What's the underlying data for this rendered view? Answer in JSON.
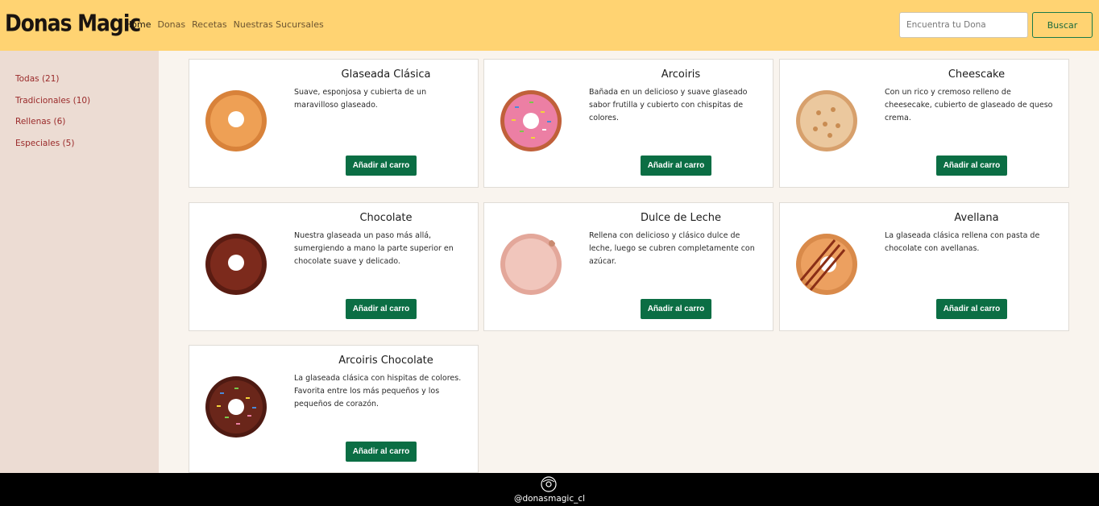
{
  "brand": "Donas Magic",
  "nav": {
    "home": "Home",
    "donas": "Donas",
    "recetas": "Recetas",
    "sucursales": "Nuestras Sucursales"
  },
  "search": {
    "placeholder": "Encuentra tu Dona",
    "button": "Buscar"
  },
  "sidebar": {
    "items": [
      {
        "label": "Todas (21)"
      },
      {
        "label": "Tradicionales (10)"
      },
      {
        "label": "Rellenas (6)"
      },
      {
        "label": "Especiales (5)"
      }
    ]
  },
  "products": [
    {
      "title": "Glaseada Clásica",
      "desc": "Suave, esponjosa y cubierta de un maravilloso glaseado.",
      "button": "Añadir al carro",
      "color": "#d8823a"
    },
    {
      "title": "Arcoiris",
      "desc": "Bañada en un delicioso y suave glaseado sabor frutilla y cubierto con chispitas de colores.",
      "button": "Añadir al carro",
      "color": "#ec7fa4"
    },
    {
      "title": "Cheescake",
      "desc": "Con un rico y cremoso relleno de cheesecake, cubierto de glaseado de queso crema.",
      "button": "Añadir al carro",
      "color": "#e5b98a"
    },
    {
      "title": "Chocolate",
      "desc": "Nuestra glaseada un paso más allá, sumergiendo a mano la parte superior en chocolate suave y delicado.",
      "button": "Añadir al carro",
      "color": "#6b2418"
    },
    {
      "title": "Dulce de Leche",
      "desc": "Rellena con delicioso y clásico dulce de leche, luego se cubren completamente con azúcar.",
      "button": "Añadir al carro",
      "color": "#e9b4a8"
    },
    {
      "title": "Avellana",
      "desc": "La glaseada clásica rellena con pasta de chocolate con avellanas.",
      "button": "Añadir al carro",
      "color": "#d98a4a"
    },
    {
      "title": "Arcoiris Chocolate",
      "desc": "La glaseada clásica con hispitas de colores. Favorita entre los más pequeños y los pequeños de corazón.",
      "button": "Añadir al carro",
      "color": "#5e2218"
    }
  ],
  "footer": {
    "handle": "@donasmagic_cl"
  }
}
